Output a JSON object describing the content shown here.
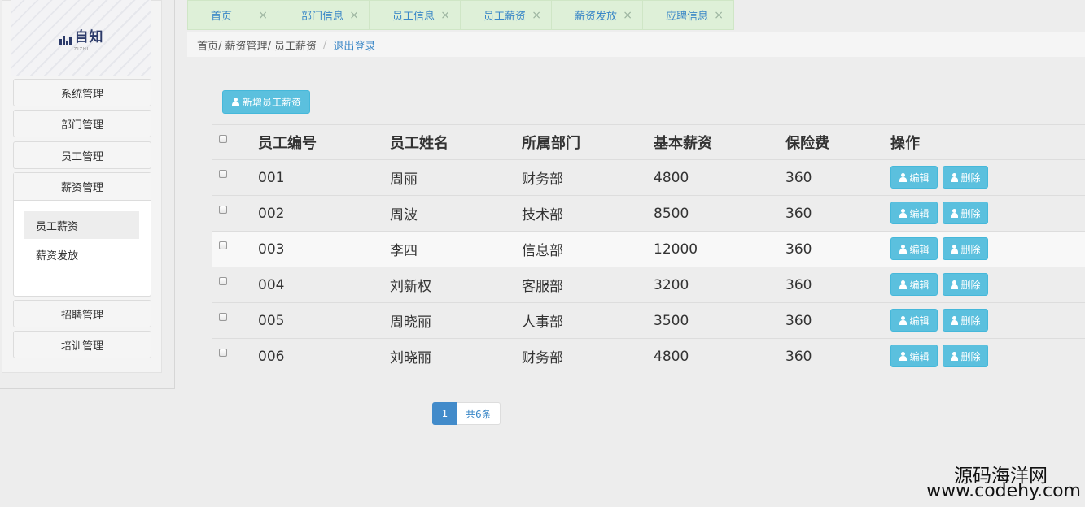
{
  "logo": {
    "text": "自知",
    "subtext": "ZIZHI"
  },
  "sidebar": {
    "items": [
      {
        "label": "系统管理"
      },
      {
        "label": "部门管理"
      },
      {
        "label": "员工管理"
      },
      {
        "label": "薪资管理",
        "expanded": true,
        "children": [
          {
            "label": "员工薪资",
            "active": true
          },
          {
            "label": "薪资发放"
          }
        ]
      },
      {
        "label": "招聘管理"
      },
      {
        "label": "培训管理"
      }
    ]
  },
  "tabs": [
    {
      "label": "首页",
      "close": "×"
    },
    {
      "label": "部门信息",
      "close": "×"
    },
    {
      "label": "员工信息",
      "close": "×"
    },
    {
      "label": "员工薪资",
      "close": "×"
    },
    {
      "label": "薪资发放",
      "close": "×"
    },
    {
      "label": "应聘信息",
      "close": "×"
    }
  ],
  "breadcrumb": {
    "path": "首页/ 薪资管理/ 员工薪资",
    "separator": "/",
    "logout": "退出登录"
  },
  "toolbar": {
    "add_label": "新增员工薪资"
  },
  "table": {
    "headers": [
      "员工编号",
      "员工姓名",
      "所属部门",
      "基本薪资",
      "保险费",
      "操作"
    ],
    "rows": [
      {
        "id": "001",
        "name": "周丽",
        "dept": "财务部",
        "salary": "4800",
        "insurance": "360"
      },
      {
        "id": "002",
        "name": "周波",
        "dept": "技术部",
        "salary": "8500",
        "insurance": "360"
      },
      {
        "id": "003",
        "name": "李四",
        "dept": "信息部",
        "salary": "12000",
        "insurance": "360"
      },
      {
        "id": "004",
        "name": "刘新权",
        "dept": "客服部",
        "salary": "3200",
        "insurance": "360"
      },
      {
        "id": "005",
        "name": "周晓丽",
        "dept": "人事部",
        "salary": "3500",
        "insurance": "360"
      },
      {
        "id": "006",
        "name": "刘晓丽",
        "dept": "财务部",
        "salary": "4800",
        "insurance": "360"
      }
    ],
    "edit_label": "编辑",
    "delete_label": "删除"
  },
  "pagination": {
    "current": "1",
    "total": "共6条"
  },
  "watermark": {
    "line1": "源码海洋网",
    "line2": "www.codehy.com"
  },
  "colors": {
    "accent": "#5bc0de",
    "primary": "#428bca",
    "tab_bg": "#def0d8",
    "link": "#3a87c7"
  }
}
